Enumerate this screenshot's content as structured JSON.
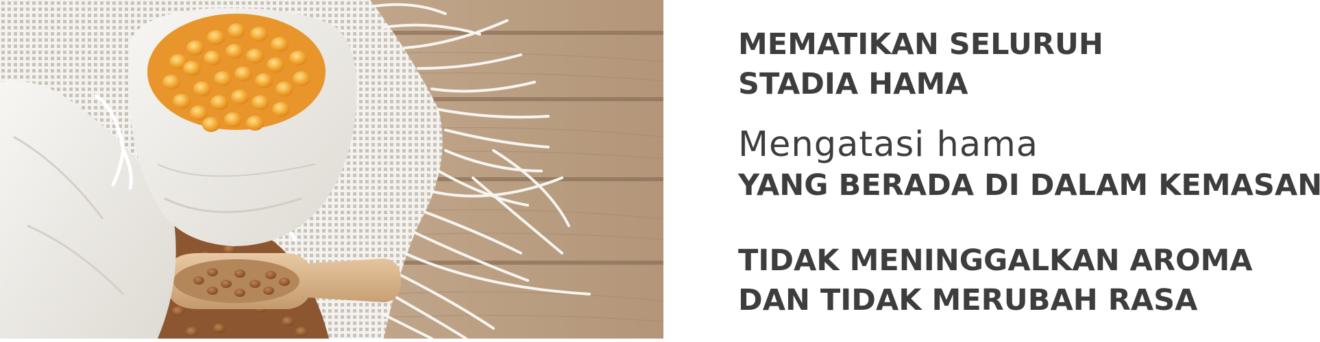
{
  "photo": {
    "alt_icon": "product-photo-icon"
  },
  "benefits": {
    "line1": "MEMATIKAN SELURUH",
    "line2": "STADIA HAMA",
    "line3": "Mengatasi hama",
    "line4": "YANG BERADA DI DALAM KEMASAN",
    "line5": "TIDAK MENINGGALKAN AROMA",
    "line6": "DAN TIDAK MERUBAH RASA"
  },
  "colors": {
    "text": "#3d3d3d",
    "background": "#ffffff",
    "wood": "#b89c80",
    "corn": "#f0a030",
    "buckwheat": "#9a6235",
    "sack": "#eeebe6"
  }
}
